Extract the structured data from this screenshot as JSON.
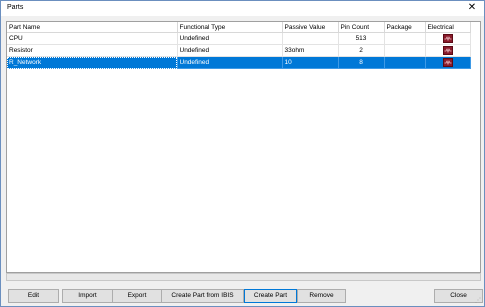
{
  "window": {
    "title": "Parts",
    "close_glyph": "✕"
  },
  "table": {
    "columns": [
      "Part Name",
      "Functional Type",
      "Passive Value",
      "Pin Count",
      "Package",
      "Electrical"
    ],
    "rows": [
      {
        "part_name": "CPU",
        "functional_type": "Undefined",
        "passive_value": "",
        "pin_count": "513",
        "package": "",
        "electrical_icon": "electrical-model-icon",
        "selected": false
      },
      {
        "part_name": "Resistor",
        "functional_type": "Undefined",
        "passive_value": "33ohm",
        "pin_count": "2",
        "package": "",
        "electrical_icon": "electrical-model-icon",
        "selected": false
      },
      {
        "part_name": "R_Network",
        "functional_type": "Undefined",
        "passive_value": "10",
        "pin_count": "8",
        "package": "",
        "electrical_icon": "electrical-model-icon",
        "selected": true
      }
    ]
  },
  "buttons": {
    "edit": "Edit",
    "import": "Import",
    "export": "Export",
    "create_from_ibis": "Create Part from IBIS",
    "create_part": "Create Part",
    "remove": "Remove",
    "close": "Close"
  },
  "colors": {
    "selection": "#0078d7",
    "icon": "#8a1a2a"
  }
}
